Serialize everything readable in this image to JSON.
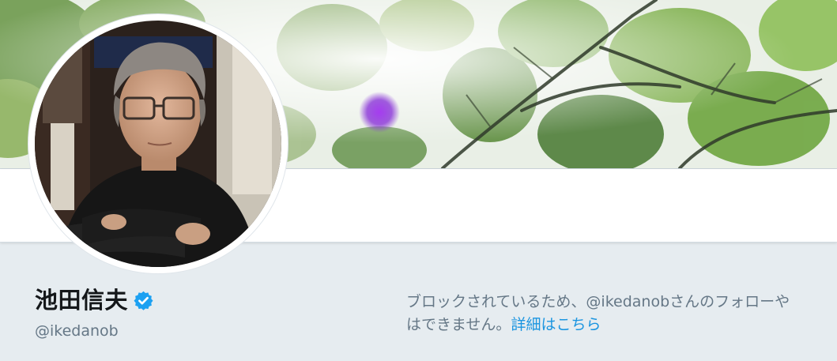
{
  "profile": {
    "name": "池田信夫",
    "handle": "@ikedanob",
    "verified": true
  },
  "blocked_notice": {
    "line1": "ブロックされているため、@ikedanobさんのフォローや",
    "line2_text": "はできません。",
    "link_label": "詳細はこちら"
  },
  "colors": {
    "background": "#e6ecf0",
    "name_text": "#14171a",
    "muted_text": "#657786",
    "link": "#1b95e0",
    "verified_badge": "#1da1f2"
  },
  "icons": {
    "verified": "verified-badge-icon"
  }
}
